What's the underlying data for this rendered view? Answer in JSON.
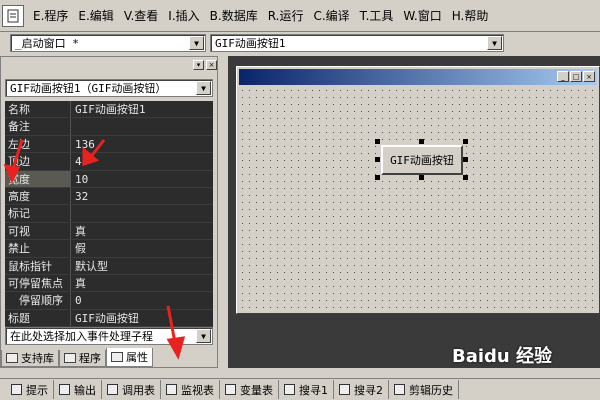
{
  "menu": {
    "items": [
      {
        "label": "E.程序"
      },
      {
        "label": "E.编辑"
      },
      {
        "label": "V.查看"
      },
      {
        "label": "I.插入"
      },
      {
        "label": "B.数据库"
      },
      {
        "label": "R.运行"
      },
      {
        "label": "C.编译"
      },
      {
        "label": "T.工具"
      },
      {
        "label": "W.窗口"
      },
      {
        "label": "H.帮助"
      }
    ]
  },
  "toolbar": {
    "window_combo": "_启动窗口 *",
    "object_combo": "GIF动画按钮1"
  },
  "properties": {
    "object_combo": "GIF动画按钮1（GIF动画按钮）",
    "rows": [
      {
        "name": "名称",
        "value": "GIF动画按钮1"
      },
      {
        "name": "备注",
        "value": ""
      },
      {
        "name": "左边",
        "value": "136"
      },
      {
        "name": "顶边",
        "value": "48"
      },
      {
        "name": "宽度",
        "value": "10"
      },
      {
        "name": "高度",
        "value": "32"
      },
      {
        "name": "标记",
        "value": ""
      },
      {
        "name": "可视",
        "value": "真"
      },
      {
        "name": "禁止",
        "value": "假"
      },
      {
        "name": "鼠标指针",
        "value": "默认型"
      },
      {
        "name": "可停留焦点",
        "value": "真"
      },
      {
        "name": "停留顺序",
        "value": "0"
      },
      {
        "name": "标题",
        "value": "GIF动画按钮"
      }
    ],
    "event_combo": "在此处选择加入事件处理子程",
    "tabs": [
      {
        "label": "支持库"
      },
      {
        "label": "程序"
      },
      {
        "label": "属性"
      }
    ]
  },
  "designer": {
    "gif_button_label": "GIF动画按钮"
  },
  "bottom_tabs": [
    {
      "label": "提示"
    },
    {
      "label": "输出"
    },
    {
      "label": "调用表"
    },
    {
      "label": "监视表"
    },
    {
      "label": "变量表"
    },
    {
      "label": "搜寻1"
    },
    {
      "label": "搜寻2"
    },
    {
      "label": "剪辑历史"
    }
  ],
  "watermark": "Baidu 经验",
  "colors": {
    "annotation_arrow": "#e8231f",
    "titlebar_start": "#0a246a",
    "titlebar_end": "#a6caf0"
  }
}
